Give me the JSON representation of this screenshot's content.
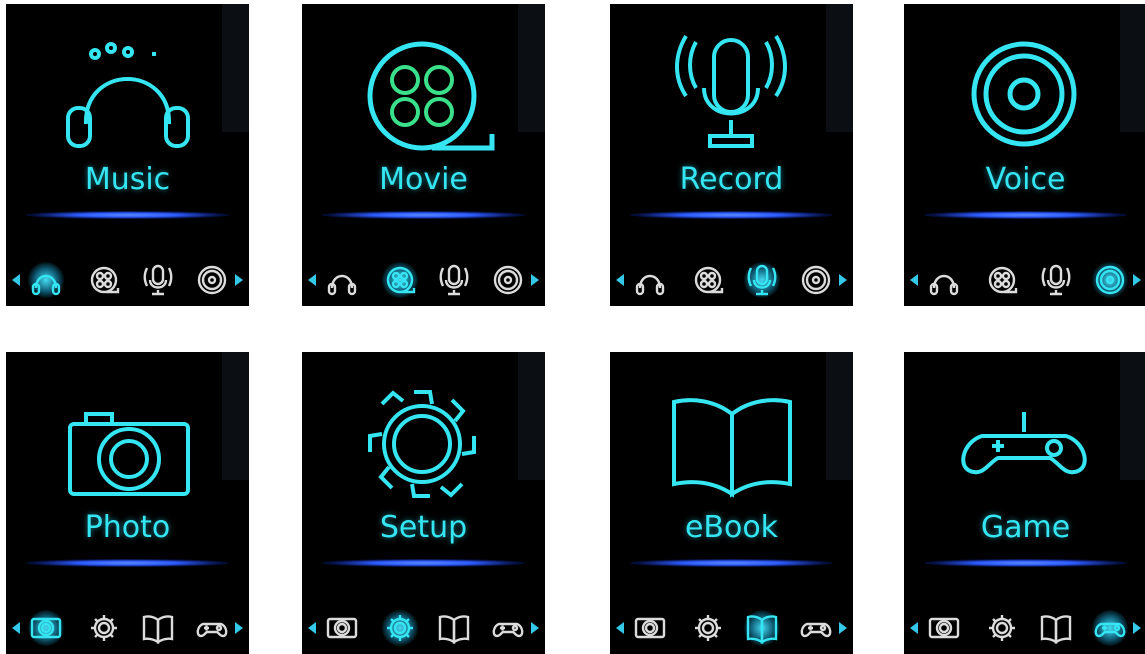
{
  "screens": [
    {
      "title": "Music",
      "selected": 0,
      "group": "a"
    },
    {
      "title": "Movie",
      "selected": 1,
      "group": "a"
    },
    {
      "title": "Record",
      "selected": 2,
      "group": "a"
    },
    {
      "title": "Voice",
      "selected": 3,
      "group": "a"
    },
    {
      "title": "Photo",
      "selected": 0,
      "group": "b"
    },
    {
      "title": "Setup",
      "selected": 1,
      "group": "b"
    },
    {
      "title": "eBook",
      "selected": 2,
      "group": "b"
    },
    {
      "title": "Game",
      "selected": 3,
      "group": "b"
    }
  ],
  "groups": {
    "a": [
      "music-icon",
      "movie-icon",
      "record-icon",
      "voice-icon"
    ],
    "b": [
      "photo-icon",
      "setup-icon",
      "ebook-icon",
      "game-icon"
    ]
  },
  "colors": {
    "accent": "#35e6f2",
    "bar": "#2d5bff",
    "tray_icon": "#dcdcdc"
  }
}
